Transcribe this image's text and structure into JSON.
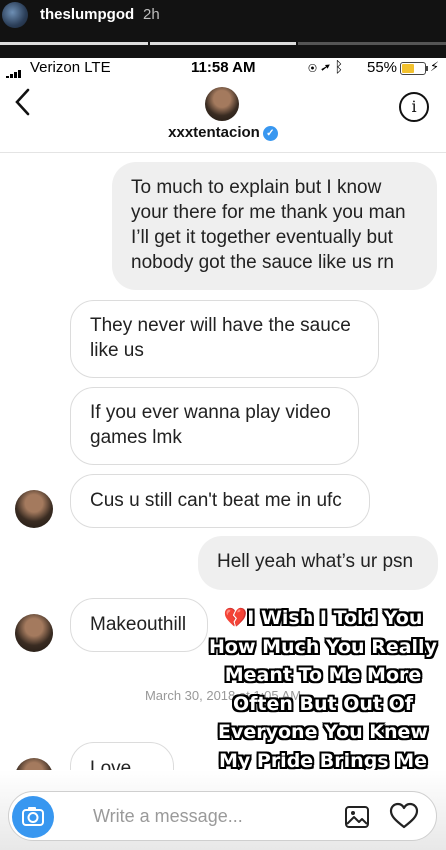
{
  "story": {
    "username": "theslumpgod",
    "time_ago": "2h"
  },
  "status_bar": {
    "carrier": "Verizon  LTE",
    "time": "11:58 AM",
    "battery_pct": "55%",
    "battery_level": 0.55
  },
  "thread": {
    "name": "xxxtentacion",
    "verified": true
  },
  "messages": [
    {
      "from": "me",
      "text": "To much to explain but I know your there for me thank you man I’ll get it together eventually but nobody got the sauce like us rn"
    },
    {
      "from": "them",
      "text": "They never will have the sauce like us"
    },
    {
      "from": "them",
      "text": "If you ever wanna play video games lmk"
    },
    {
      "from": "them",
      "text": "Cus u still can't beat me in ufc"
    },
    {
      "from": "me",
      "text": "Hell yeah what’s ur psn"
    },
    {
      "from": "them",
      "text": "Makeouthill"
    },
    {
      "from": "them",
      "text": "Love ya"
    }
  ],
  "date_separator": "March 30, 2018 at 1:05 AM",
  "overlay": {
    "emoji": "💔",
    "text": "I Wish I Told You How Much You Really Meant To Me More Often But Out Of Everyone You Knew My Pride Brings Me Down"
  },
  "composer": {
    "placeholder": "Write a message..."
  },
  "icons": {
    "back": "chevron-left-icon",
    "info": "info-icon",
    "camera": "camera-icon",
    "gallery": "gallery-icon",
    "like": "heart-icon"
  },
  "colors": {
    "verified_blue": "#3897f0",
    "outgoing_bubble": "#efefef",
    "battery_yellow": "#f2c12e",
    "overlay_heart": "#d6253a"
  }
}
